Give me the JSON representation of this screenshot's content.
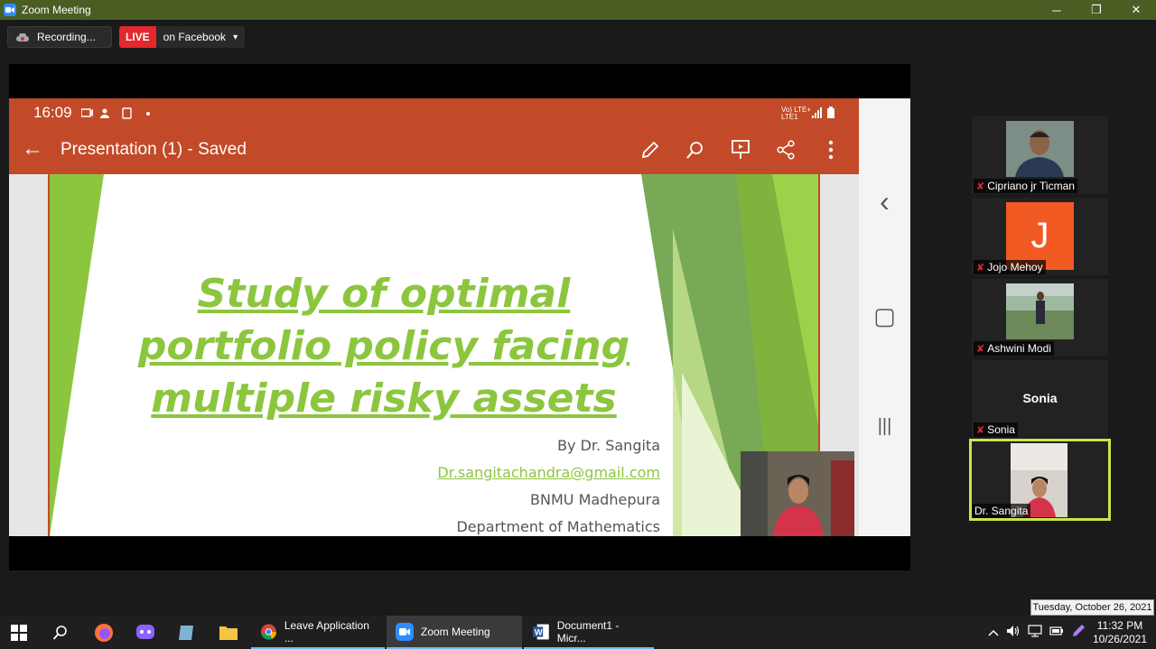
{
  "window": {
    "title": "Zoom Meeting",
    "minimize": "─",
    "restore": "❐",
    "close": "✕"
  },
  "toolbar": {
    "recording_label": "Recording...",
    "live_badge": "LIVE",
    "live_target": "on Facebook",
    "live_caret": "▾"
  },
  "phone": {
    "time": "16:09",
    "status_right": "Vo) LTE+ LTE1",
    "back_icon": "←",
    "doc_title": "Presentation (1) - Saved",
    "nav_back": "‹",
    "nav_home": "▢",
    "nav_recents": "|||"
  },
  "slide": {
    "title_line1": "Study of optimal",
    "title_line2": "portfolio policy facing",
    "title_line3": "multiple risky assets",
    "author": "By Dr. Sangita",
    "email": "Dr.sangitachandra@gmail.com",
    "institution": "BNMU Madhepura",
    "department": "Department of Mathematics",
    "colors": {
      "accent": "#8cc63f",
      "bar": "#c24a28"
    }
  },
  "participants": [
    {
      "name": "Cipriano jr Ticman",
      "muted": true,
      "type": "video"
    },
    {
      "name": "Jojo Mehoy",
      "muted": true,
      "type": "avatar",
      "initial": "J",
      "color": "#f15a22"
    },
    {
      "name": "Ashwini Modi",
      "muted": true,
      "type": "video"
    },
    {
      "name": "Sonia",
      "muted": true,
      "type": "name-only",
      "display": "Sonia"
    },
    {
      "name": "Dr. Sangita",
      "muted": false,
      "type": "video",
      "active": true
    }
  ],
  "tooltip": "Tuesday, October 26, 2021",
  "taskbar": {
    "apps": [
      {
        "label": "Leave Application ...",
        "icon": "chrome-icon"
      },
      {
        "label": "Zoom Meeting",
        "icon": "zoom-icon"
      },
      {
        "label": "Document1 - Micr...",
        "icon": "word-icon"
      }
    ],
    "time": "11:32 PM",
    "date": "10/26/2021"
  }
}
